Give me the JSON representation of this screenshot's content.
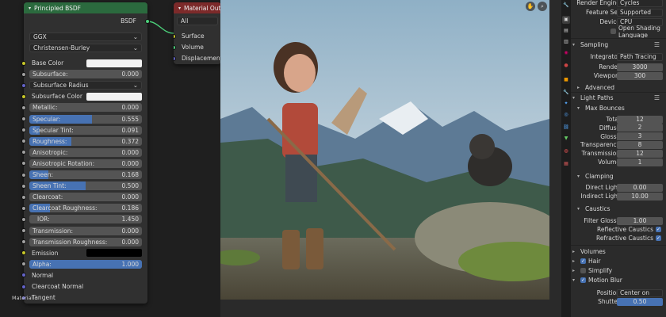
{
  "node_editor": {
    "bsdf_node": {
      "title": "Principled BSDF",
      "output_label": "BSDF",
      "distribution": "GGX",
      "subsurface_method": "Christensen-Burley",
      "rows": [
        {
          "label": "Base Color",
          "kind": "color",
          "color": "#f2f2f2",
          "socket": "yellow"
        },
        {
          "label": "Subsurface:",
          "value": "0.000",
          "kind": "slider",
          "fill": 0,
          "socket": "grey"
        },
        {
          "label": "Subsurface Radius",
          "kind": "dropdown",
          "socket": "purple"
        },
        {
          "label": "Subsurface Color",
          "kind": "color",
          "color": "#f2f2f2",
          "socket": "yellow"
        },
        {
          "label": "Metallic:",
          "value": "0.000",
          "kind": "slider",
          "fill": 0,
          "socket": "grey"
        },
        {
          "label": "Specular:",
          "value": "0.555",
          "kind": "slider",
          "fill": 0.555,
          "socket": "grey"
        },
        {
          "label": "Specular Tint:",
          "value": "0.091",
          "kind": "slider",
          "fill": 0.091,
          "socket": "grey"
        },
        {
          "label": "Roughness:",
          "value": "0.372",
          "kind": "slider",
          "fill": 0.372,
          "socket": "grey"
        },
        {
          "label": "Anisotropic:",
          "value": "0.000",
          "kind": "slider",
          "fill": 0,
          "socket": "grey"
        },
        {
          "label": "Anisotropic Rotation:",
          "value": "0.000",
          "kind": "slider",
          "fill": 0,
          "socket": "grey"
        },
        {
          "label": "Sheen:",
          "value": "0.168",
          "kind": "slider",
          "fill": 0.168,
          "socket": "grey"
        },
        {
          "label": "Sheen Tint:",
          "value": "0.500",
          "kind": "slider",
          "fill": 0.5,
          "socket": "grey"
        },
        {
          "label": "Clearcoat:",
          "value": "0.000",
          "kind": "slider",
          "fill": 0,
          "socket": "grey"
        },
        {
          "label": "Clearcoat Roughness:",
          "value": "0.186",
          "kind": "slider",
          "fill": 0.186,
          "socket": "grey"
        },
        {
          "label": "IOR:",
          "value": "1.450",
          "kind": "number",
          "socket": "grey"
        },
        {
          "label": "Transmission:",
          "value": "0.000",
          "kind": "slider",
          "fill": 0,
          "socket": "grey"
        },
        {
          "label": "Transmission Roughness:",
          "value": "0.000",
          "kind": "slider",
          "fill": 0,
          "socket": "grey"
        },
        {
          "label": "Emission",
          "kind": "color",
          "color": "#000000",
          "socket": "yellow"
        },
        {
          "label": "Alpha:",
          "value": "1.000",
          "kind": "slider",
          "fill": 1,
          "socket": "grey"
        },
        {
          "label": "Normal",
          "kind": "plain",
          "socket": "purple"
        },
        {
          "label": "Clearcoat Normal",
          "kind": "plain",
          "socket": "purple"
        },
        {
          "label": "Tangent",
          "kind": "plain",
          "socket": "purple"
        }
      ]
    },
    "output_node": {
      "title": "Material Output",
      "target": "All",
      "inputs": [
        "Surface",
        "Volume",
        "Displacement"
      ]
    },
    "corner_label": "Material"
  },
  "viewport": {
    "icons": [
      "hand-icon",
      "zoom-icon"
    ]
  },
  "properties": {
    "render_engine_label": "Render Engine",
    "render_engine": "Cycles",
    "feature_set_label": "Feature Set",
    "feature_set": "Supported",
    "device_label": "Device",
    "device": "CPU",
    "osl_label": "Open Shading Language",
    "sampling": {
      "title": "Sampling",
      "integrator_label": "Integrator",
      "integrator": "Path Tracing",
      "render_label": "Render",
      "render": "3000",
      "viewport_label": "Viewport",
      "viewport": "300",
      "advanced": "Advanced"
    },
    "light_paths": {
      "title": "Light Paths",
      "max_bounces": "Max Bounces",
      "rows": [
        {
          "label": "Total",
          "value": "12"
        },
        {
          "label": "Diffuse",
          "value": "2"
        },
        {
          "label": "Glossy",
          "value": "3"
        },
        {
          "label": "Transparency",
          "value": "8"
        },
        {
          "label": "Transmission",
          "value": "12"
        },
        {
          "label": "Volume",
          "value": "1"
        }
      ],
      "clamping": "Clamping",
      "direct_light_label": "Direct Light",
      "direct_light": "0.00",
      "indirect_light_label": "Indirect Light",
      "indirect_light": "10.00",
      "caustics": "Caustics",
      "filter_glossy_label": "Filter Glossy",
      "filter_glossy": "1.00",
      "reflective_label": "Reflective Caustics",
      "refractive_label": "Refractive Caustics"
    },
    "volumes": "Volumes",
    "hair": "Hair",
    "simplify": "Simplify",
    "motion_blur": "Motion Blur",
    "position_label": "Position",
    "position": "Center on Frame",
    "shutter_label": "Shutter",
    "shutter": "0.50"
  }
}
